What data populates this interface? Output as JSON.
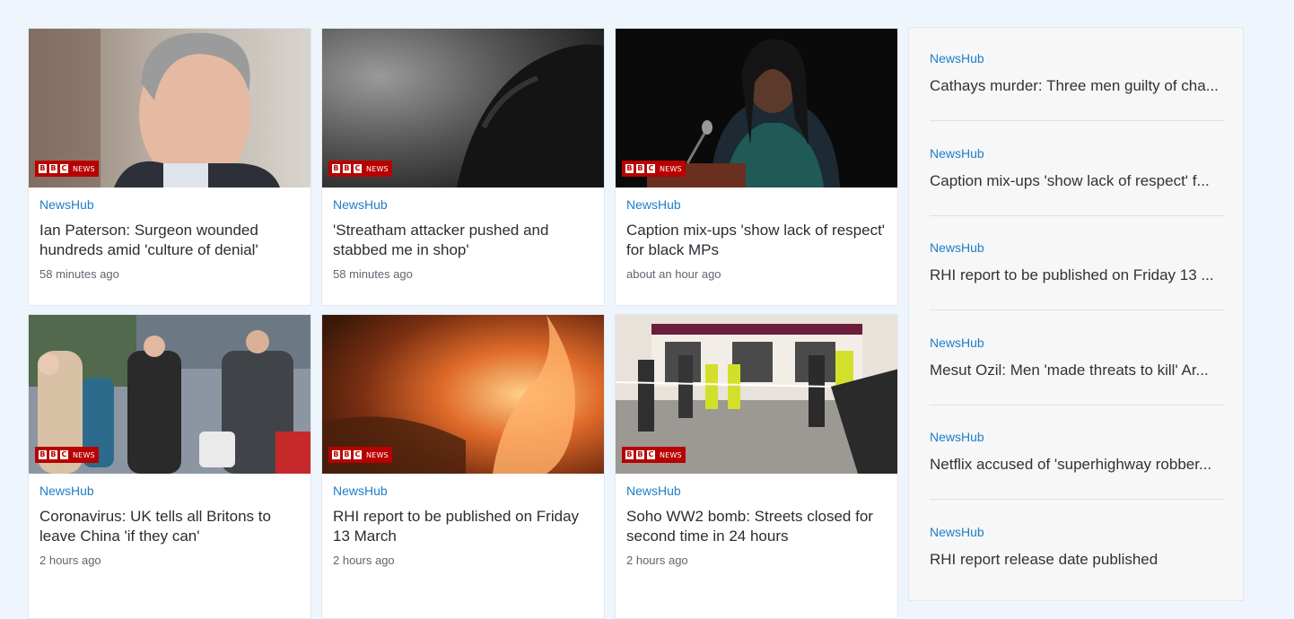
{
  "badge": {
    "brand": "BBC",
    "suffix": "NEWS"
  },
  "cards": [
    {
      "source": "NewsHub",
      "headline": "Ian Paterson: Surgeon wounded hundreds amid 'culture of denial'",
      "time": "58 minutes ago"
    },
    {
      "source": "NewsHub",
      "headline": "'Streatham attacker pushed and stabbed me in shop'",
      "time": "58 minutes ago"
    },
    {
      "source": "NewsHub",
      "headline": "Caption mix-ups 'show lack of respect' for black MPs",
      "time": "about an hour ago"
    },
    {
      "source": "NewsHub",
      "headline": "Coronavirus: UK tells all Britons to leave China 'if they can'",
      "time": "2 hours ago"
    },
    {
      "source": "NewsHub",
      "headline": "RHI report to be published on Friday 13 March",
      "time": "2 hours ago"
    },
    {
      "source": "NewsHub",
      "headline": "Soho WW2 bomb: Streets closed for second time in 24 hours",
      "time": "2 hours ago"
    }
  ],
  "sidebar": {
    "items": [
      {
        "source": "NewsHub",
        "headline": "Cathays murder: Three men guilty of cha..."
      },
      {
        "source": "NewsHub",
        "headline": "Caption mix-ups 'show lack of respect' f..."
      },
      {
        "source": "NewsHub",
        "headline": "RHI report to be published on Friday 13 ..."
      },
      {
        "source": "NewsHub",
        "headline": "Mesut Ozil: Men 'made threats to kill' Ar..."
      },
      {
        "source": "NewsHub",
        "headline": "Netflix accused of 'superhighway robber..."
      },
      {
        "source": "NewsHub",
        "headline": "RHI report release date published"
      }
    ]
  },
  "colors": {
    "page_bg": "#eef5fc",
    "source_link": "#1f7dc5",
    "badge_red": "#b80000"
  }
}
